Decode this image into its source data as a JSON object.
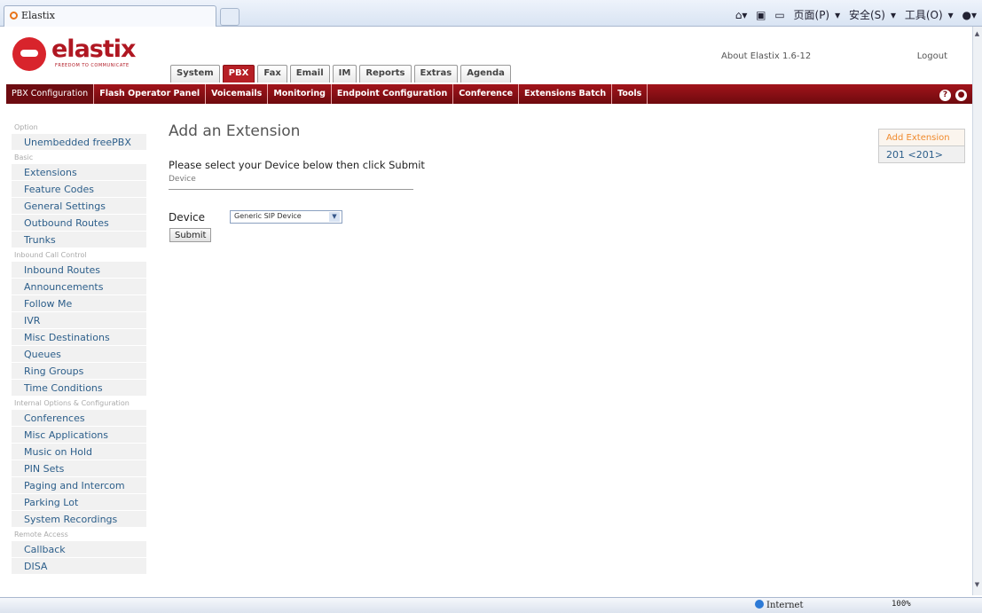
{
  "browser": {
    "tab_title": "Elastix",
    "commands": [
      "页面(P)",
      "安全(S)",
      "工具(O)"
    ]
  },
  "header": {
    "logo_text": "elastix",
    "logo_tagline": "FREEDOM TO COMMUNICATE",
    "about": "About Elastix 1.6-12",
    "logout": "Logout"
  },
  "main_tabs": [
    "System",
    "PBX",
    "Fax",
    "Email",
    "IM",
    "Reports",
    "Extras",
    "Agenda"
  ],
  "sub_nav": [
    "PBX Configuration",
    "Flash Operator Panel",
    "Voicemails",
    "Monitoring",
    "Endpoint Configuration",
    "Conference",
    "Extensions Batch",
    "Tools"
  ],
  "sidebar": [
    {
      "section": "Option",
      "items": [
        "Unembedded freePBX"
      ]
    },
    {
      "section": "Basic",
      "items": [
        "Extensions",
        "Feature Codes",
        "General Settings",
        "Outbound Routes",
        "Trunks"
      ]
    },
    {
      "section": "Inbound Call Control",
      "items": [
        "Inbound Routes",
        "Announcements",
        "Follow Me",
        "IVR",
        "Misc Destinations",
        "Queues",
        "Ring Groups",
        "Time Conditions"
      ]
    },
    {
      "section": "Internal Options & Configuration",
      "items": [
        "Conferences",
        "Misc Applications",
        "Music on Hold",
        "PIN Sets",
        "Paging and Intercom",
        "Parking Lot",
        "System Recordings"
      ]
    },
    {
      "section": "Remote Access",
      "items": [
        "Callback",
        "DISA"
      ]
    }
  ],
  "content": {
    "title": "Add an Extension",
    "instruction": "Please select your Device below then click Submit",
    "device_heading": "Device",
    "device_label": "Device",
    "device_value": "Generic SIP Device",
    "submit_label": "Submit"
  },
  "right_box": {
    "add_extension": "Add Extension",
    "extension": "201 <201>"
  },
  "statusbar": {
    "zone": "Internet",
    "zoom": "100%"
  }
}
